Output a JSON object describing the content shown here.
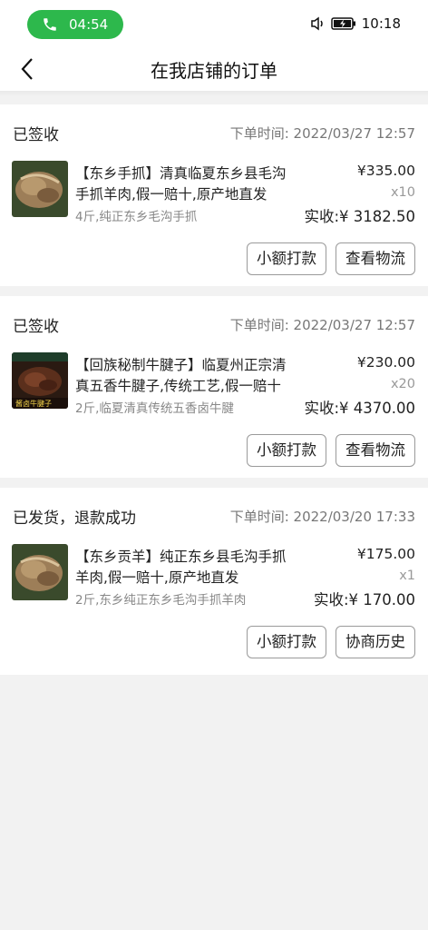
{
  "statusbar": {
    "call_time": "04:54",
    "clock": "10:18"
  },
  "navbar": {
    "title": "在我店铺的订单"
  },
  "orders": [
    {
      "status": "已签收",
      "time": "下单时间: 2022/03/27 12:57",
      "title": "【东乡手抓】清真临夏东乡县毛沟手抓羊肉,假一赔十,原产地直发",
      "spec": "4斤,纯正东乡毛沟手抓",
      "price": "¥335.00",
      "qty": "x10",
      "paid": "实收:¥ 3182.50",
      "buttons": [
        "小额打款",
        "查看物流"
      ],
      "thumb_color": "#8b6b48"
    },
    {
      "status": "已签收",
      "time": "下单时间: 2022/03/27 12:57",
      "title": "【回族秘制牛腱子】临夏州正宗清真五香牛腱子,传统工艺,假一赔十",
      "spec": "2斤,临夏清真传统五香卤牛腱",
      "price": "¥230.00",
      "qty": "x20",
      "paid": "实收:¥ 4370.00",
      "buttons": [
        "小额打款",
        "查看物流"
      ],
      "thumb_color": "#3d2418",
      "thumb_caption": "酱卤牛腱子"
    },
    {
      "status": "已发货，退款成功",
      "time": "下单时间: 2022/03/20 17:33",
      "title": "【东乡贡羊】纯正东乡县毛沟手抓羊肉,假一赔十,原产地直发",
      "spec": "2斤,东乡纯正东乡毛沟手抓羊肉",
      "price": "¥175.00",
      "qty": "x1",
      "paid": "实收:¥ 170.00",
      "buttons": [
        "小额打款",
        "协商历史"
      ],
      "thumb_color": "#8b6b48"
    }
  ]
}
